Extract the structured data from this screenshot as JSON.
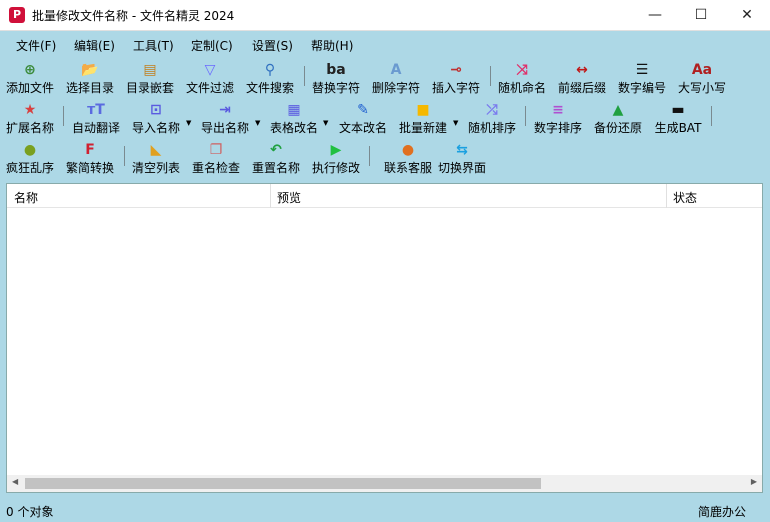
{
  "window": {
    "title": "批量修改文件名称 - 文件名精灵 2024",
    "app_icon": "P",
    "minimize": "—",
    "maximize": "☐",
    "close": "✕"
  },
  "menu": [
    "文件(F)",
    "编辑(E)",
    "工具(T)",
    "定制(C)",
    "设置(S)",
    "帮助(H)"
  ],
  "toolbar": [
    {
      "label": "添加文件",
      "icon": "add-file-icon",
      "glyph": "⊕",
      "color": "#3a8a3a"
    },
    {
      "label": "选择目录",
      "icon": "folder-open-icon",
      "glyph": "📂",
      "color": "#e0a020"
    },
    {
      "label": "目录嵌套",
      "icon": "nested-folder-icon",
      "glyph": "▤",
      "color": "#c08020"
    },
    {
      "label": "文件过滤",
      "icon": "filter-icon",
      "glyph": "▽",
      "color": "#6a6aff"
    },
    {
      "label": "文件搜索",
      "icon": "search-icon",
      "glyph": "⚲",
      "color": "#3070c0"
    },
    {
      "label": "替换字符",
      "icon": "replace-char-icon",
      "glyph": "ba",
      "color": "#222"
    },
    {
      "label": "删除字符",
      "icon": "delete-char-icon",
      "glyph": "A",
      "color": "#6a9ad0"
    },
    {
      "label": "插入字符",
      "icon": "insert-char-icon",
      "glyph": "⊸",
      "color": "#c03030"
    },
    {
      "label": "随机命名",
      "icon": "shuffle-icon",
      "glyph": "⤨",
      "color": "#e0306a"
    },
    {
      "label": "前缀后缀",
      "icon": "arrows-both-icon",
      "glyph": "↔",
      "color": "#c01818"
    },
    {
      "label": "数字编号",
      "icon": "numbered-list-icon",
      "glyph": "☰",
      "color": "#111"
    },
    {
      "label": "大写小写",
      "icon": "case-icon",
      "glyph": "Aa",
      "color": "#b02020"
    },
    {
      "label": "扩展名称",
      "icon": "star-icon",
      "glyph": "★",
      "color": "#d84040"
    },
    {
      "label": "自动翻译",
      "icon": "translate-icon",
      "glyph": "тT",
      "color": "#5a6ae0"
    },
    {
      "label": "导入名称",
      "icon": "import-icon",
      "glyph": "⊡",
      "color": "#5a5ae0"
    },
    {
      "label": "导出名称",
      "icon": "export-icon",
      "glyph": "⇥",
      "color": "#5a5ae0"
    },
    {
      "label": "表格改名",
      "icon": "table-icon",
      "glyph": "▦",
      "color": "#5a5ae0"
    },
    {
      "label": "文本改名",
      "icon": "edit-icon",
      "glyph": "✎",
      "color": "#2060d0"
    },
    {
      "label": "批量新建",
      "icon": "folder-icon",
      "glyph": "■",
      "color": "#f5b800"
    },
    {
      "label": "随机排序",
      "icon": "random-sort-icon",
      "glyph": "⤮",
      "color": "#7a7aee"
    },
    {
      "label": "数字排序",
      "icon": "lines-icon",
      "glyph": "≡",
      "color": "#b050d0"
    },
    {
      "label": "备份还原",
      "icon": "drive-icon",
      "glyph": "▲",
      "color": "#20a040"
    },
    {
      "label": "生成BAT",
      "icon": "terminal-icon",
      "glyph": "▬",
      "color": "#111"
    },
    {
      "label": "疯狂乱序",
      "icon": "monster-icon",
      "glyph": "●",
      "color": "#7aa020"
    },
    {
      "label": "繁简转换",
      "icon": "f-letter-icon",
      "glyph": "F",
      "color": "#d02030"
    },
    {
      "label": "清空列表",
      "icon": "broom-icon",
      "glyph": "◣",
      "color": "#e0a020"
    },
    {
      "label": "重名检查",
      "icon": "duplicate-icon",
      "glyph": "❐",
      "color": "#d06060"
    },
    {
      "label": "重置名称",
      "icon": "undo-icon",
      "glyph": "↶",
      "color": "#20a040"
    },
    {
      "label": "执行修改",
      "icon": "play-icon",
      "glyph": "▶",
      "color": "#20c040"
    },
    {
      "label": "联系客服",
      "icon": "support-icon",
      "glyph": "●",
      "color": "#e07020"
    },
    {
      "label": "切换界面",
      "icon": "switch-icon",
      "glyph": "⇆",
      "color": "#1aa0e0"
    }
  ],
  "list": {
    "columns": [
      "名称",
      "预览",
      "状态"
    ]
  },
  "statusbar": {
    "count": "0 个对象",
    "brand": "简鹿办公"
  }
}
